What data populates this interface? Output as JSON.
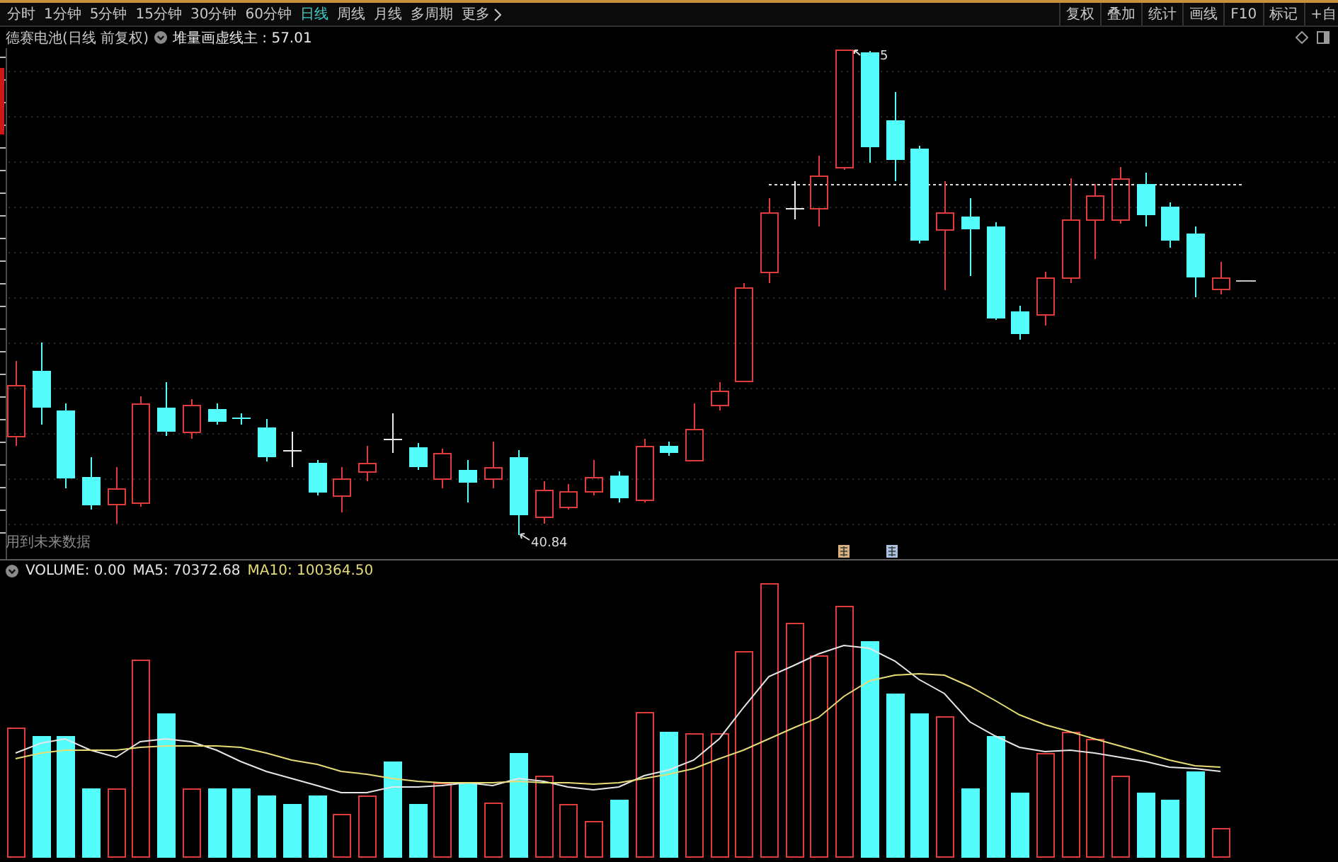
{
  "toolbar": {
    "periods": [
      {
        "label": "分时",
        "kind": "period",
        "selected": false
      },
      {
        "label": "1分钟",
        "kind": "period",
        "selected": false
      },
      {
        "label": "5分钟",
        "kind": "period",
        "selected": false
      },
      {
        "label": "15分钟",
        "kind": "period",
        "selected": false
      },
      {
        "label": "30分钟",
        "kind": "period",
        "selected": false
      },
      {
        "label": "60分钟",
        "kind": "period",
        "selected": false
      },
      {
        "label": "日线",
        "kind": "period",
        "selected": true
      },
      {
        "label": "周线",
        "kind": "period",
        "selected": false
      },
      {
        "label": "月线",
        "kind": "period",
        "selected": false
      },
      {
        "label": "多周期",
        "kind": "period",
        "selected": false
      },
      {
        "label": "更多",
        "kind": "menu",
        "selected": false
      }
    ],
    "tools": [
      "复权",
      "叠加",
      "统计",
      "画线",
      "F10",
      "标记",
      "+自"
    ]
  },
  "chart_header": {
    "title": "德赛电池(日线 前复权)",
    "indicator": "堆量画虚线主 : 57.01"
  },
  "price_chart": {
    "high_label": "5",
    "low_label": "40.84",
    "notice": "用到未来数据",
    "event_markers": [
      {
        "color": "#d8b080"
      },
      {
        "color": "#a8c0e0"
      }
    ]
  },
  "volume_panel": {
    "legend": [
      {
        "text": "VOLUME: 0.00",
        "color": "#e6e6e6"
      },
      {
        "text": "MA5: 70372.68",
        "color": "#e6e6e6"
      },
      {
        "text": "MA10: 100364.50",
        "color": "#e6dc78"
      }
    ]
  }
}
